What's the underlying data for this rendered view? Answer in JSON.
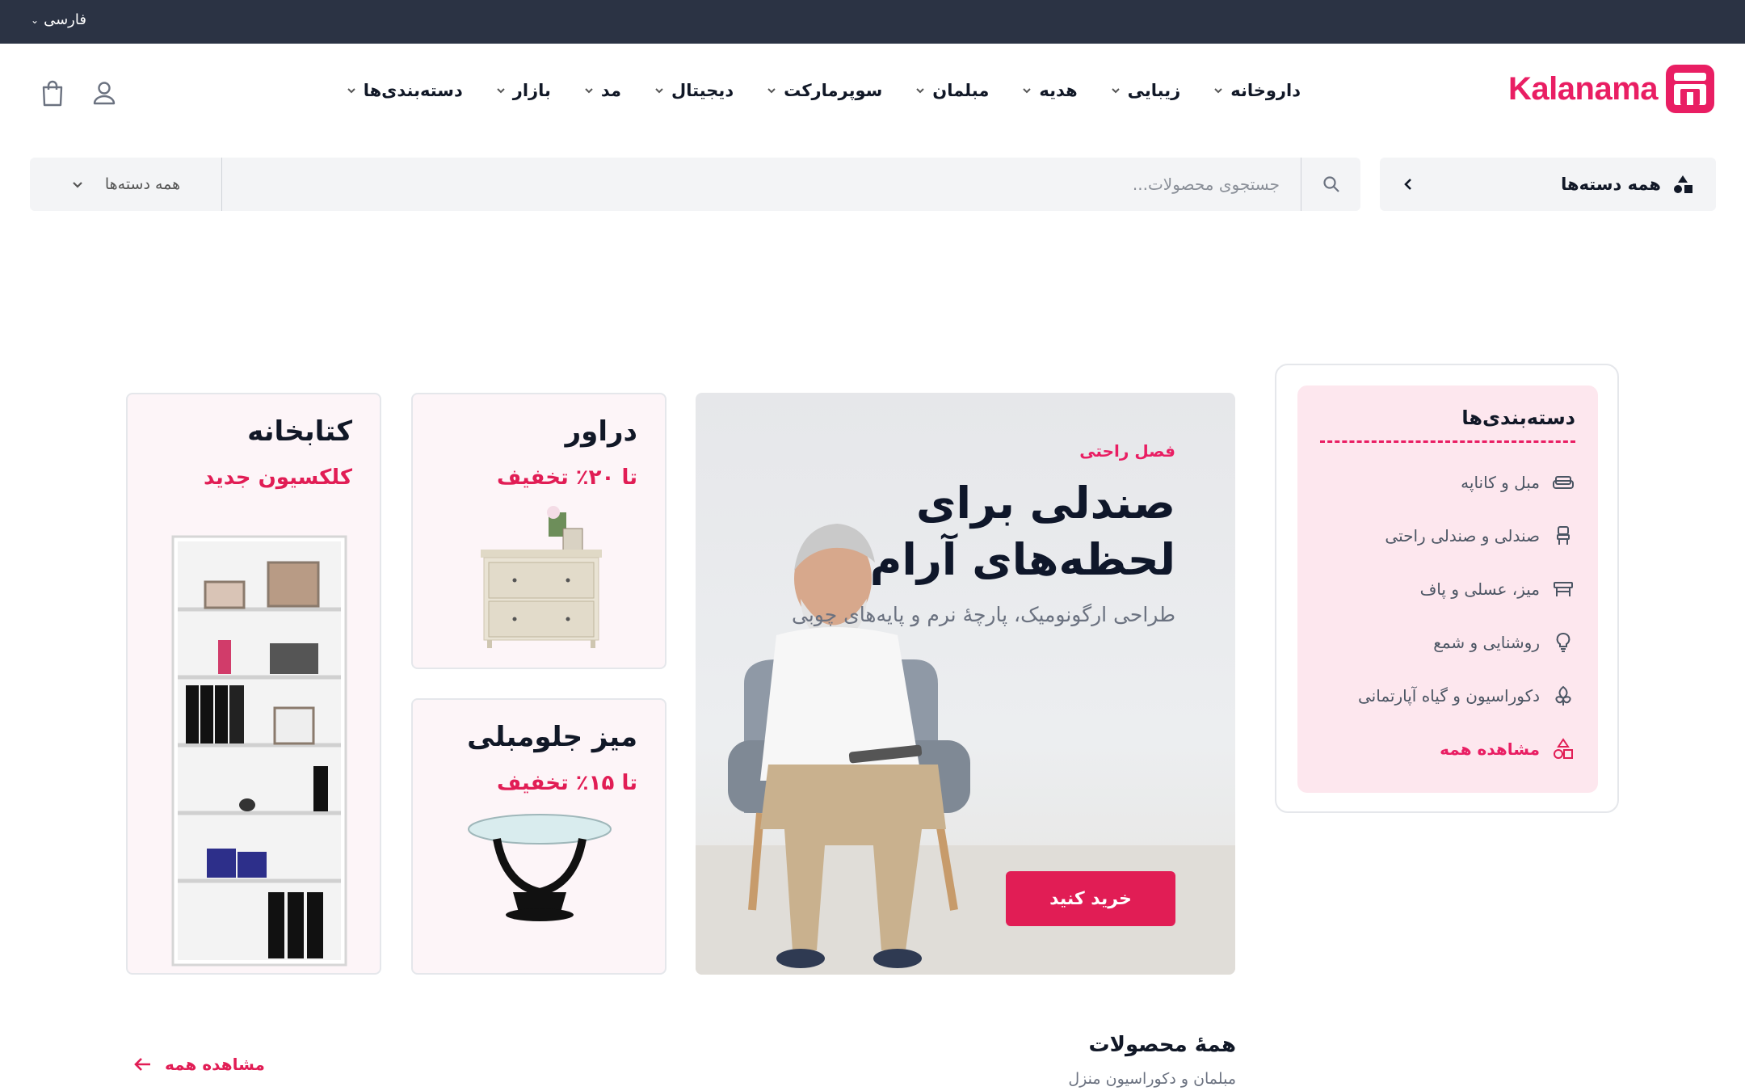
{
  "topbar": {
    "language": "فارسی"
  },
  "brand": {
    "name": "Kalanama",
    "color": "#e91e63"
  },
  "nav": {
    "items": [
      {
        "label": "دسته‌بندی‌ها"
      },
      {
        "label": "بازار"
      },
      {
        "label": "مد"
      },
      {
        "label": "دیجیتال"
      },
      {
        "label": "سوپرمارکت"
      },
      {
        "label": "مبلمان"
      },
      {
        "label": "هدیه"
      },
      {
        "label": "زیبایی"
      },
      {
        "label": "داروخانه"
      }
    ]
  },
  "header_icons": [
    "user-icon",
    "shopping-bag-icon"
  ],
  "search": {
    "all_categories_label": "همه دسته‌ها",
    "placeholder": "جستجوی محصولات...",
    "category_select": "همه دسته‌ها"
  },
  "categories_panel": {
    "title": "دسته‌بندی‌ها",
    "items": [
      {
        "label": "مبل و کاناپه",
        "icon": "sofa-icon"
      },
      {
        "label": "صندلی و صندلی راحتی",
        "icon": "chair-icon"
      },
      {
        "label": "میز، عسلی و پاف",
        "icon": "table-icon"
      },
      {
        "label": "روشنایی و شمع",
        "icon": "lightbulb-icon"
      },
      {
        "label": "دکوراسیون و گیاه آپارتمانی",
        "icon": "plant-icon"
      },
      {
        "label": "مشاهده همه",
        "icon": "shapes-icon"
      }
    ]
  },
  "hero": {
    "tag": "فصل راحتی",
    "title": "صندلی برای لحظه‌های آرام",
    "subtitle": "طراحی ارگونومیک، پارچهٔ نرم و پایه‌های چوبی",
    "cta": "خرید کنید"
  },
  "promos": [
    {
      "title": "دراور",
      "subtitle": "تا ۲۰٪ تخفیف"
    },
    {
      "title": "میز جلومبلی",
      "subtitle": "تا ۱۵٪ تخفیف"
    },
    {
      "title": "کتابخانه",
      "subtitle": "کلکسیون جدید"
    }
  ],
  "products_section": {
    "title": "همهٔ محصولات",
    "subtitle": "مبلمان و دکوراسیون منزل",
    "view_all": "مشاهده همه"
  },
  "colors": {
    "accent": "#e11d55",
    "topbar": "#2b3344",
    "panel_pink": "#fde7ee"
  }
}
